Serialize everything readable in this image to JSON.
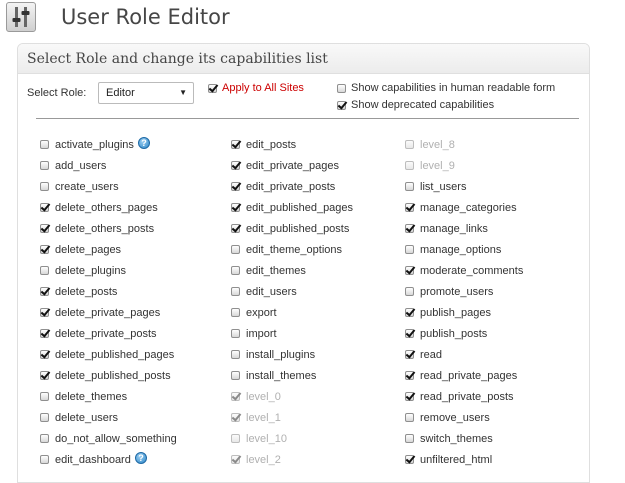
{
  "header": {
    "title": "User Role Editor",
    "icon": "sliders-icon"
  },
  "panel": {
    "title": "Select Role and change its capabilities list",
    "role_label": "Select Role:",
    "role_value": "Editor",
    "apply_all_label": "Apply to All Sites",
    "apply_all_checked": true,
    "human_readable_label": "Show capabilities in human readable form",
    "human_readable_checked": false,
    "deprecated_label": "Show deprecated capabilities",
    "deprecated_checked": true
  },
  "colors": {
    "accent_red": "#cc0000",
    "disabled_text": "#b0b0b0"
  },
  "capabilities": [
    [
      {
        "name": "activate_plugins",
        "checked": false,
        "help": true
      },
      {
        "name": "add_users",
        "checked": false
      },
      {
        "name": "create_users",
        "checked": false
      },
      {
        "name": "delete_others_pages",
        "checked": true
      },
      {
        "name": "delete_others_posts",
        "checked": true
      },
      {
        "name": "delete_pages",
        "checked": true
      },
      {
        "name": "delete_plugins",
        "checked": false
      },
      {
        "name": "delete_posts",
        "checked": true
      },
      {
        "name": "delete_private_pages",
        "checked": true
      },
      {
        "name": "delete_private_posts",
        "checked": true
      },
      {
        "name": "delete_published_pages",
        "checked": true
      },
      {
        "name": "delete_published_posts",
        "checked": true
      },
      {
        "name": "delete_themes",
        "checked": false
      },
      {
        "name": "delete_users",
        "checked": false
      },
      {
        "name": "do_not_allow_something",
        "checked": false
      },
      {
        "name": "edit_dashboard",
        "checked": false,
        "help": true
      }
    ],
    [
      {
        "name": "edit_posts",
        "checked": true
      },
      {
        "name": "edit_private_pages",
        "checked": true
      },
      {
        "name": "edit_private_posts",
        "checked": true
      },
      {
        "name": "edit_published_pages",
        "checked": true
      },
      {
        "name": "edit_published_posts",
        "checked": true
      },
      {
        "name": "edit_theme_options",
        "checked": false
      },
      {
        "name": "edit_themes",
        "checked": false
      },
      {
        "name": "edit_users",
        "checked": false
      },
      {
        "name": "export",
        "checked": false
      },
      {
        "name": "import",
        "checked": false
      },
      {
        "name": "install_plugins",
        "checked": false
      },
      {
        "name": "install_themes",
        "checked": false
      },
      {
        "name": "level_0",
        "checked": true,
        "disabled": true
      },
      {
        "name": "level_1",
        "checked": true,
        "disabled": true
      },
      {
        "name": "level_10",
        "checked": false,
        "disabled": true
      },
      {
        "name": "level_2",
        "checked": true,
        "disabled": true
      }
    ],
    [
      {
        "name": "level_8",
        "checked": false,
        "disabled": true
      },
      {
        "name": "level_9",
        "checked": false,
        "disabled": true
      },
      {
        "name": "list_users",
        "checked": false
      },
      {
        "name": "manage_categories",
        "checked": true
      },
      {
        "name": "manage_links",
        "checked": true
      },
      {
        "name": "manage_options",
        "checked": false
      },
      {
        "name": "moderate_comments",
        "checked": true
      },
      {
        "name": "promote_users",
        "checked": false
      },
      {
        "name": "publish_pages",
        "checked": true
      },
      {
        "name": "publish_posts",
        "checked": true
      },
      {
        "name": "read",
        "checked": true
      },
      {
        "name": "read_private_pages",
        "checked": true
      },
      {
        "name": "read_private_posts",
        "checked": true
      },
      {
        "name": "remove_users",
        "checked": false
      },
      {
        "name": "switch_themes",
        "checked": false
      },
      {
        "name": "unfiltered_html",
        "checked": true
      }
    ]
  ]
}
